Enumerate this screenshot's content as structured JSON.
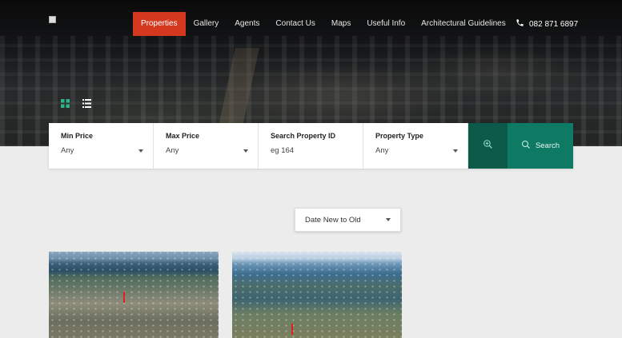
{
  "nav": {
    "items": [
      "Properties",
      "Gallery",
      "Agents",
      "Contact Us",
      "Maps",
      "Useful Info",
      "Architectural Guidelines"
    ],
    "active_index": 0,
    "phone": "082 871 6897"
  },
  "search": {
    "fields": [
      {
        "label": "Min Price",
        "value": "Any"
      },
      {
        "label": "Max Price",
        "value": "Any"
      },
      {
        "label": "Search Property ID",
        "value": "eg 164"
      },
      {
        "label": "Property Type",
        "value": "Any"
      }
    ],
    "button_label": "Search"
  },
  "sort": {
    "selected": "Date New to Old"
  },
  "colors": {
    "accent_nav": "#d4391f",
    "search_dark": "#0c5a4a",
    "search_green": "#0f7a64",
    "view_grid": "#2bb58f"
  },
  "icons": {
    "grid": "grid-view-icon",
    "list": "list-view-icon",
    "phone": "phone-icon",
    "advanced": "zoom-plus-icon",
    "search": "search-icon"
  }
}
